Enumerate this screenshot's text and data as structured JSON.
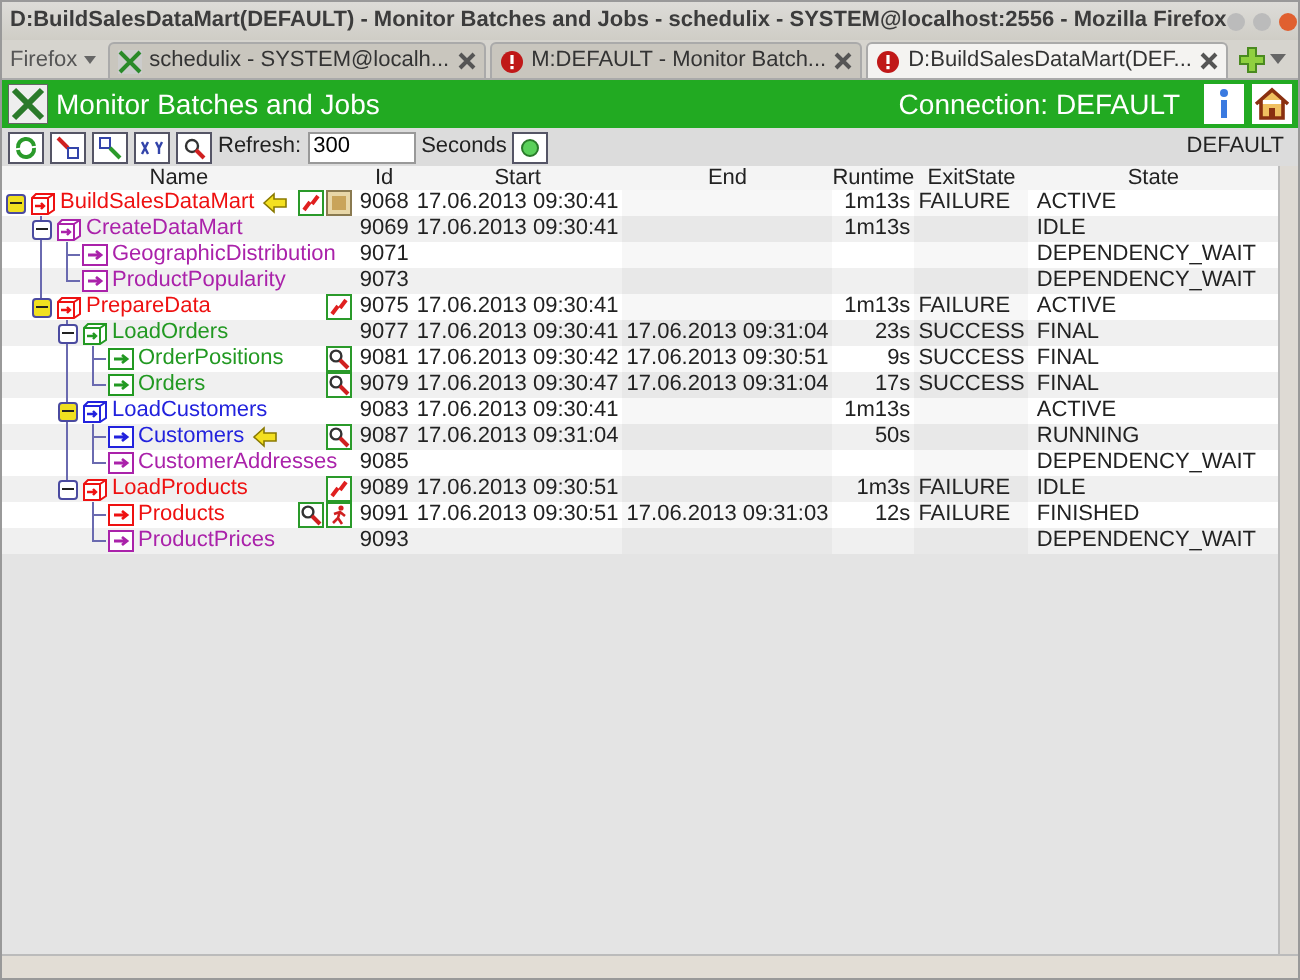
{
  "window": {
    "title": "D:BuildSalesDataMart(DEFAULT) - Monitor Batches and Jobs - schedulix - SYSTEM@localhost:2556 - Mozilla Firefox"
  },
  "browser": {
    "menu": "Firefox",
    "tabs": [
      {
        "label": "schedulix - SYSTEM@localh...",
        "selected": false,
        "kind": "app"
      },
      {
        "label": "M:DEFAULT - Monitor Batch...",
        "selected": false,
        "kind": "alert"
      },
      {
        "label": "D:BuildSalesDataMart(DEF...",
        "selected": true,
        "kind": "alert"
      }
    ]
  },
  "header": {
    "title": "Monitor Batches and Jobs",
    "connection_label": "Connection:",
    "connection": "DEFAULT"
  },
  "toolbar": {
    "refresh_label": "Refresh:",
    "refresh_value": "300",
    "seconds_label": "Seconds",
    "scope": "DEFAULT"
  },
  "table": {
    "columns": [
      "Name",
      "Id",
      "Start",
      "End",
      "Runtime",
      "ExitState",
      "State"
    ],
    "rows": [
      {
        "name": "BuildSalesDataMart",
        "color": "#ee1111",
        "kind": "batch",
        "expanded": true,
        "flagged": true,
        "pointer": true,
        "actions": [
          {
            "kind": "restart"
          },
          {
            "kind": "note"
          }
        ],
        "id": "9068",
        "start": "17.06.2013 09:30:41",
        "runtime": "1m13s",
        "exit_state": "FAILURE",
        "state": "ACTIVE",
        "children": [
          {
            "name": "CreateDataMart",
            "color": "#aa22aa",
            "kind": "batch",
            "expanded": true,
            "flagged": false,
            "pointer": false,
            "id": "9069",
            "start": "17.06.2013 09:30:41",
            "runtime": "1m13s",
            "state": "IDLE",
            "children": [
              {
                "name": "GeographicDistribution",
                "color": "#aa22aa",
                "kind": "job",
                "pointer": false,
                "id": "9071",
                "state": "DEPENDENCY_WAIT"
              },
              {
                "name": "ProductPopularity",
                "color": "#aa22aa",
                "kind": "job",
                "pointer": false,
                "id": "9073",
                "state": "DEPENDENCY_WAIT"
              }
            ]
          },
          {
            "name": "PrepareData",
            "color": "#ee1111",
            "kind": "batch",
            "expanded": true,
            "flagged": true,
            "pointer": false,
            "actions": [
              {
                "kind": "restart"
              }
            ],
            "id": "9075",
            "start": "17.06.2013 09:30:41",
            "runtime": "1m13s",
            "exit_state": "FAILURE",
            "state": "ACTIVE",
            "children": [
              {
                "name": "LoadOrders",
                "color": "#229922",
                "kind": "batch",
                "expanded": true,
                "flagged": false,
                "pointer": false,
                "id": "9077",
                "start": "17.06.2013 09:30:41",
                "end": "17.06.2013 09:31:04",
                "runtime": "23s",
                "exit_state": "SUCCESS",
                "state": "FINAL",
                "children": [
                  {
                    "name": "OrderPositions",
                    "color": "#229922",
                    "kind": "job",
                    "pointer": false,
                    "actions": [
                      {
                        "kind": "log"
                      }
                    ],
                    "id": "9081",
                    "start": "17.06.2013 09:30:42",
                    "end": "17.06.2013 09:30:51",
                    "runtime": "9s",
                    "exit_state": "SUCCESS",
                    "state": "FINAL"
                  },
                  {
                    "name": "Orders",
                    "color": "#229922",
                    "kind": "job",
                    "pointer": false,
                    "actions": [
                      {
                        "kind": "log"
                      }
                    ],
                    "id": "9079",
                    "start": "17.06.2013 09:30:47",
                    "end": "17.06.2013 09:31:04",
                    "runtime": "17s",
                    "exit_state": "SUCCESS",
                    "state": "FINAL"
                  }
                ]
              },
              {
                "name": "LoadCustomers",
                "color": "#2222dd",
                "kind": "batch",
                "expanded": true,
                "flagged": true,
                "pointer": false,
                "id": "9083",
                "start": "17.06.2013 09:30:41",
                "runtime": "1m13s",
                "state": "ACTIVE",
                "children": [
                  {
                    "name": "Customers",
                    "color": "#2222dd",
                    "kind": "job",
                    "pointer": true,
                    "actions": [
                      {
                        "kind": "log"
                      }
                    ],
                    "id": "9087",
                    "start": "17.06.2013 09:31:04",
                    "runtime": "50s",
                    "state": "RUNNING"
                  },
                  {
                    "name": "CustomerAddresses",
                    "color": "#aa22aa",
                    "kind": "job",
                    "pointer": false,
                    "id": "9085",
                    "state": "DEPENDENCY_WAIT"
                  }
                ]
              },
              {
                "name": "LoadProducts",
                "color": "#ee1111",
                "kind": "batch",
                "expanded": true,
                "flagged": false,
                "pointer": false,
                "actions": [
                  {
                    "kind": "restart"
                  }
                ],
                "id": "9089",
                "start": "17.06.2013 09:30:51",
                "runtime": "1m3s",
                "exit_state": "FAILURE",
                "state": "IDLE",
                "children": [
                  {
                    "name": "Products",
                    "color": "#ee1111",
                    "kind": "job",
                    "pointer": false,
                    "actions": [
                      {
                        "kind": "log"
                      },
                      {
                        "kind": "run"
                      }
                    ],
                    "id": "9091",
                    "start": "17.06.2013 09:30:51",
                    "end": "17.06.2013 09:31:03",
                    "runtime": "12s",
                    "exit_state": "FAILURE",
                    "state": "FINISHED"
                  },
                  {
                    "name": "ProductPrices",
                    "color": "#aa22aa",
                    "kind": "job",
                    "pointer": false,
                    "id": "9093",
                    "state": "DEPENDENCY_WAIT"
                  }
                ]
              }
            ]
          }
        ]
      }
    ]
  }
}
